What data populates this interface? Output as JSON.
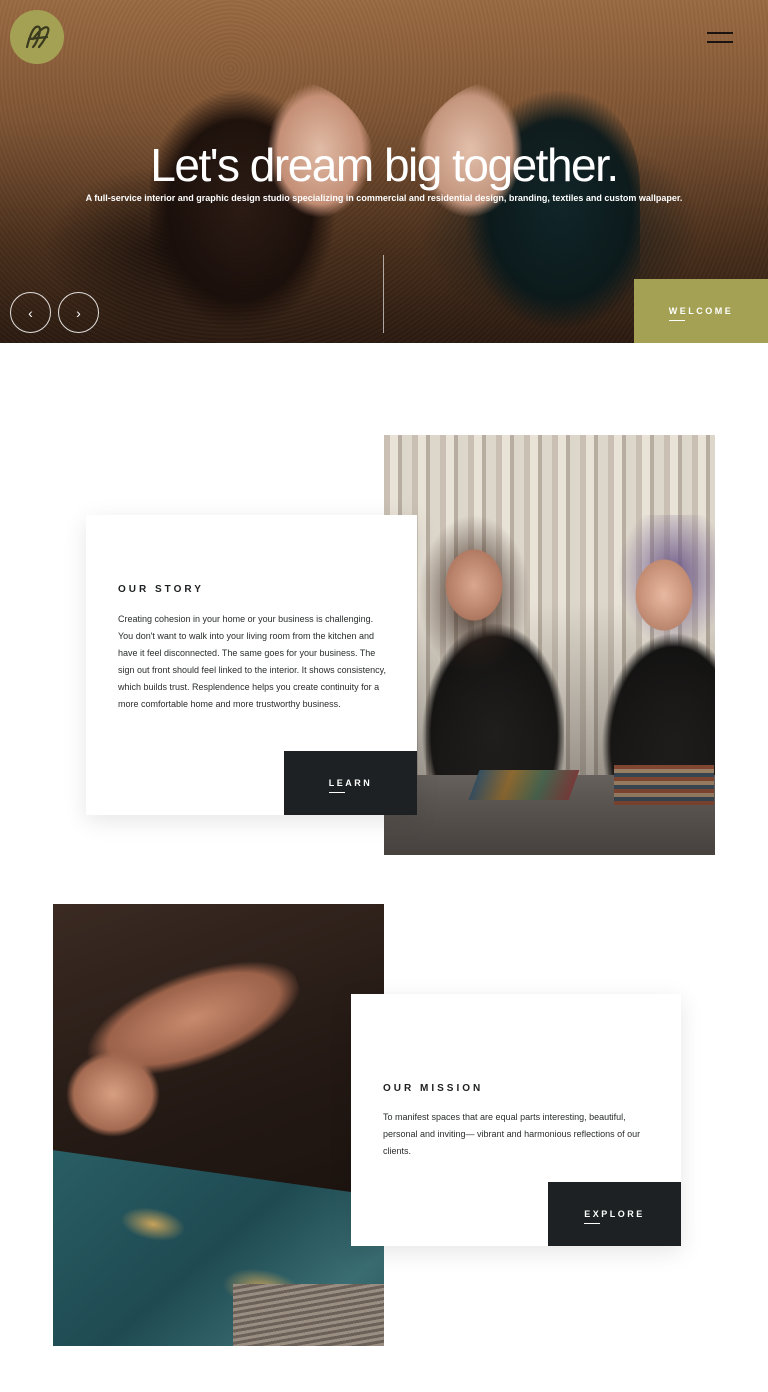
{
  "header": {
    "logo_icon": "monogram-logo",
    "logo_color": "#a4a154",
    "menu_icon": "hamburger-menu-icon"
  },
  "hero": {
    "title": "Let's dream big together.",
    "subtitle": "A full-service interior and graphic design studio specializing in commercial and residential design, branding, textiles and custom wallpaper.",
    "prev_icon": "chevron-left-icon",
    "next_icon": "chevron-right-icon",
    "prev_glyph": "‹",
    "next_glyph": "›",
    "cta_label": "WELCOME",
    "cta_color": "#a4a154"
  },
  "story": {
    "heading": "OUR STORY",
    "body": "Creating cohesion in your home or your business is challenging. You don't want to walk into your living room from the kitchen and have it feel disconnected. The same goes for your business. The sign out front should feel linked to the interior. It shows consistency, which builds trust. Resplendence helps you create continuity for a more comfortable home and more trustworthy business.",
    "cta_label": "LEARN",
    "cta_color": "#1d2123"
  },
  "mission": {
    "heading": "OUR MISSION",
    "body": "To manifest spaces that are equal parts interesting, beautiful, personal and inviting— vibrant and harmonious reflections of our clients.",
    "cta_label": "EXPLORE",
    "cta_color": "#1d2123"
  }
}
